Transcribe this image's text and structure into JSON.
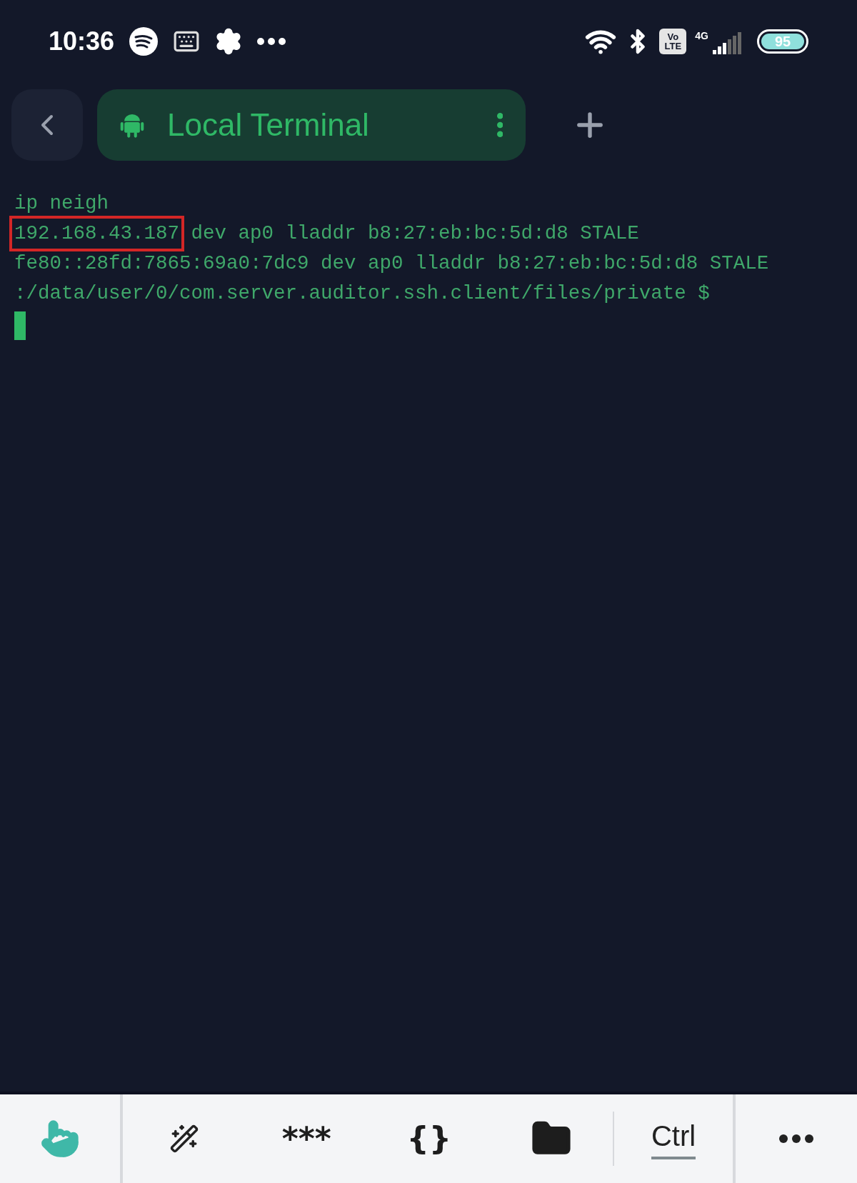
{
  "status_bar": {
    "time": "10:36",
    "volte": [
      "Vo",
      "LTE"
    ],
    "network": "4G",
    "battery": "95"
  },
  "tab_bar": {
    "tabs": [
      {
        "label": "Local Terminal",
        "selected": true
      }
    ]
  },
  "terminal": {
    "lines": [
      {
        "parts": [
          {
            "text": "ip neigh",
            "highlighted": false
          }
        ]
      },
      {
        "parts": [
          {
            "text": "192.168.43.187",
            "highlighted": true
          },
          {
            "text": " dev ap0 lladdr b8:27:eb:bc:5d:d8 STALE",
            "highlighted": false
          }
        ]
      },
      {
        "parts": [
          {
            "text": "fe80::28fd:7865:69a0:7dc9 dev ap0 lladdr b8:27:eb:bc:5d:d8 STALE",
            "highlighted": false
          }
        ]
      },
      {
        "parts": [
          {
            "text": ":/data/user/0/com.server.auditor.ssh.client/files/private $",
            "highlighted": false
          }
        ]
      }
    ],
    "cursor": true
  },
  "keyboard_bar": {
    "keys": [
      {
        "kind": "touch"
      },
      {
        "kind": "snippets"
      },
      {
        "kind": "text",
        "label": "***"
      },
      {
        "kind": "text",
        "label": "{}"
      },
      {
        "kind": "folder"
      },
      {
        "kind": "modifier",
        "label": "Ctrl"
      },
      {
        "kind": "more"
      }
    ]
  }
}
